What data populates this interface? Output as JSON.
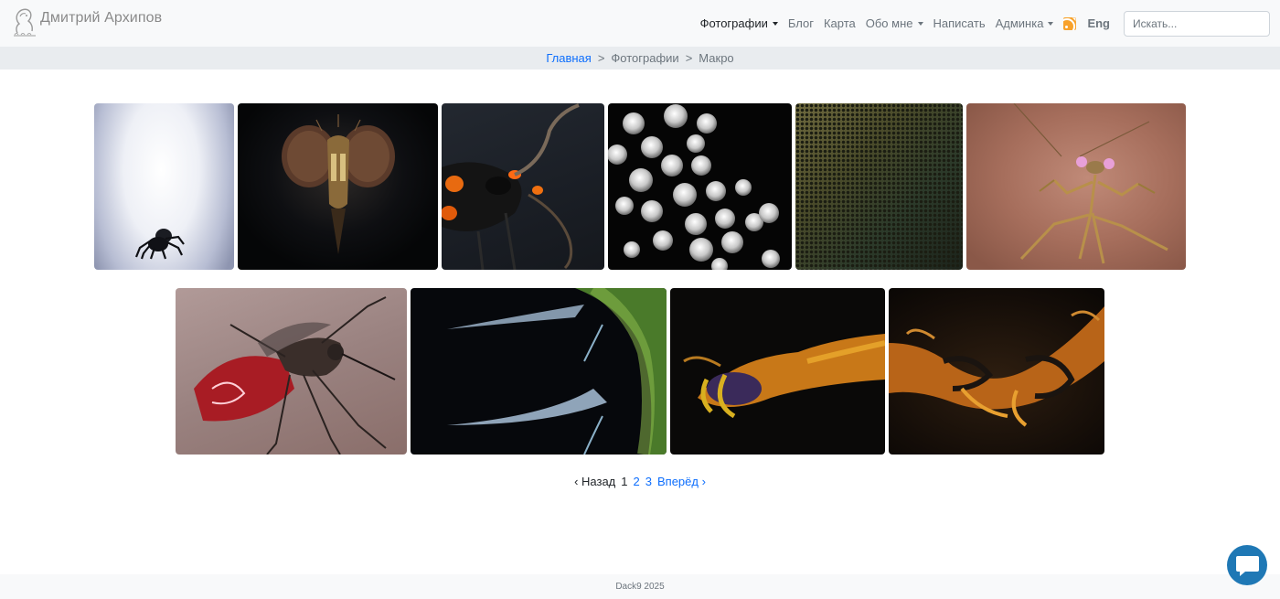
{
  "header": {
    "site_name": "Дмитрий Архипов",
    "nav": {
      "photos": "Фотографии",
      "blog": "Блог",
      "map": "Карта",
      "about": "Обо мне",
      "write": "Написать",
      "admin": "Админка",
      "lang": "Eng"
    },
    "search_placeholder": "Искать..."
  },
  "breadcrumb": {
    "home": "Главная",
    "sep": ">",
    "section": "Фотографии",
    "current": "Макро"
  },
  "gallery": {
    "photos": [
      {
        "subject": "jumping spider in white light"
      },
      {
        "subject": "fly head close-up"
      },
      {
        "subject": "wasp with antennae"
      },
      {
        "subject": "pollen grains"
      },
      {
        "subject": "compound eye texture"
      },
      {
        "subject": "praying mantis"
      },
      {
        "subject": "mosquito feeding"
      },
      {
        "subject": "insect claws green"
      },
      {
        "subject": "insect leg golden"
      },
      {
        "subject": "insect claws orange"
      }
    ]
  },
  "pagination": {
    "prev": "‹ Назад",
    "current": "1",
    "page2": "2",
    "page3": "3",
    "next": "Вперёд ›"
  },
  "footer": {
    "text": "Dack9 2025"
  },
  "colors": {
    "accent": "#0d6efd",
    "rss": "#f8a22b",
    "chat": "#1f78b5"
  }
}
